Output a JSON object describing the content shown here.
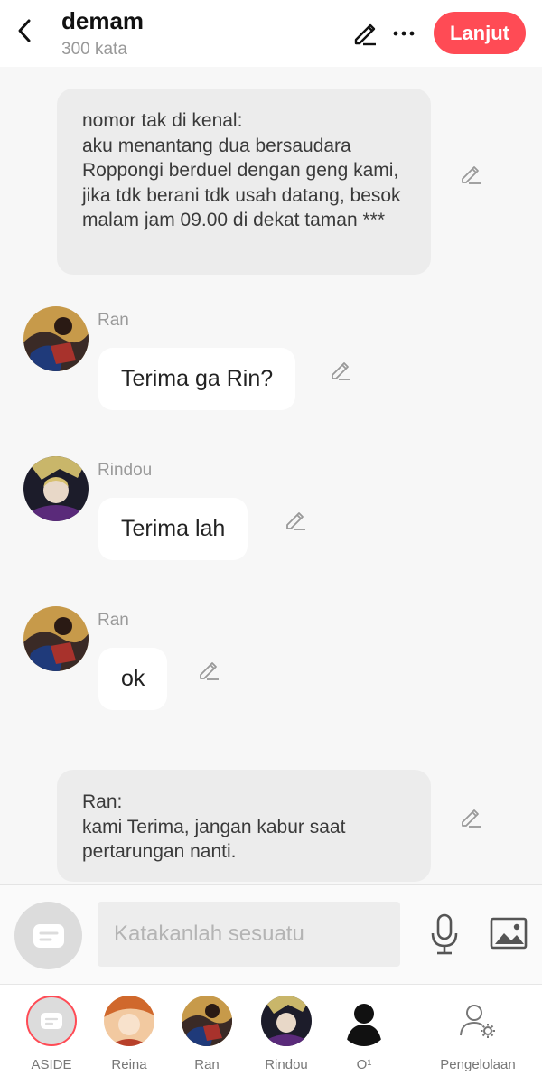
{
  "header": {
    "title": "demam",
    "subtitle": "300 kata",
    "next_label": "Lanjut"
  },
  "messages": [
    {
      "type": "narration",
      "text": "nomor tak di kenal:\naku menantang dua bersaudara Roppongi berduel dengan geng kami, jika tdk berani tdk usah datang, besok malam jam 09.00 di dekat taman ***"
    },
    {
      "type": "chat",
      "speaker": "Ran",
      "text": "Terima ga Rin?"
    },
    {
      "type": "chat",
      "speaker": "Rindou",
      "text": "Terima lah"
    },
    {
      "type": "chat",
      "speaker": "Ran",
      "text": "ok"
    },
    {
      "type": "narration",
      "text": "Ran:\nkami Terima, jangan kabur saat pertarungan nanti."
    }
  ],
  "input": {
    "placeholder": "Katakanlah sesuatu"
  },
  "characters": [
    {
      "label": "ASIDE"
    },
    {
      "label": "Reina"
    },
    {
      "label": "Ran"
    },
    {
      "label": "Rindou"
    },
    {
      "label": "O¹"
    },
    {
      "label": "Pengelolaan"
    }
  ],
  "colors": {
    "accent": "#ff4b55",
    "background": "#f7f7f7",
    "narration_bg": "#ececec",
    "bubble_bg": "#ffffff"
  }
}
